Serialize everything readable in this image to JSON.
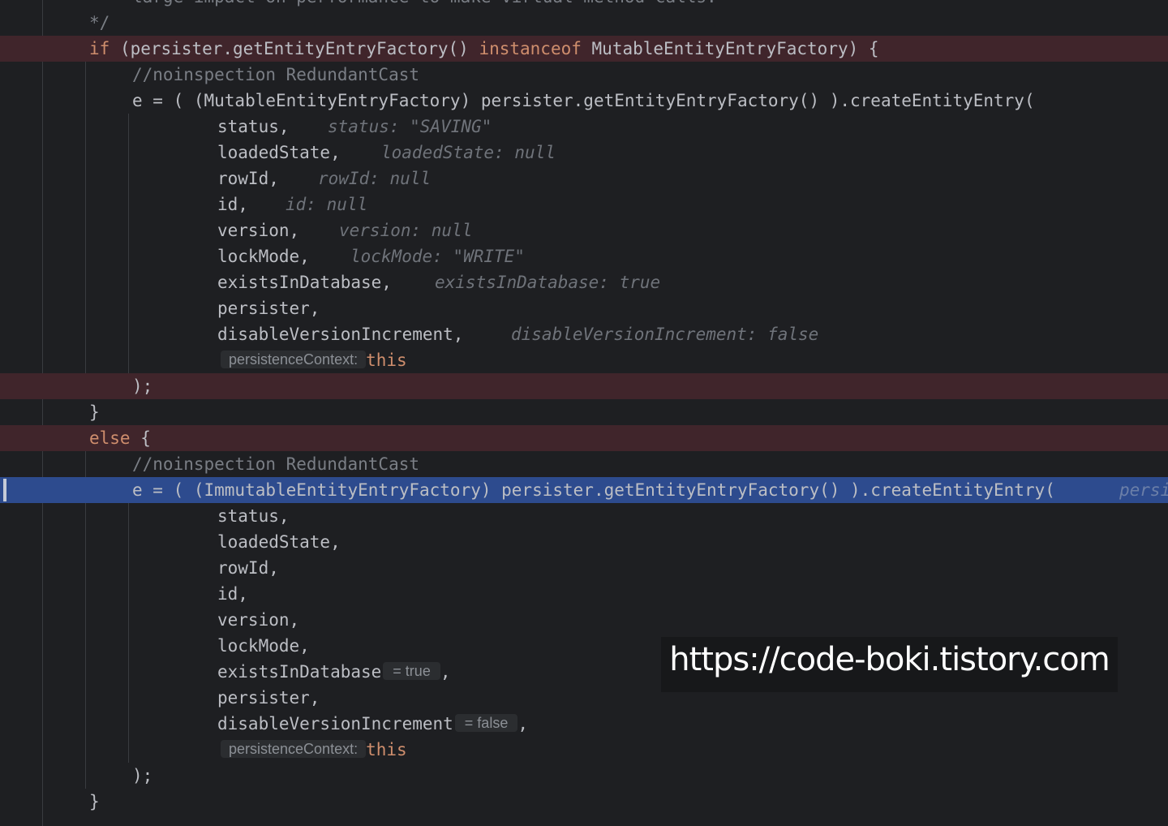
{
  "colors": {
    "background": "#1e1f22",
    "breakpoint_line": "#40252b",
    "execution_line": "#2d4b8e",
    "keyword": "#cf8e6d",
    "comment": "#7a7e85",
    "default_text": "#bcbec4"
  },
  "code": {
    "top_partial": "large impact on performance to make virtual method calls.",
    "comment_end": "*/",
    "if_kw": "if",
    "if_mid": " (persister.getEntityEntryFactory() ",
    "instanceof_kw": "instanceof",
    "if_tail": " MutableEntityEntryFactory) {",
    "noinspection_1": "//noinspection RedundantCast",
    "mutable_call": "e = ( (MutableEntityEntryFactory) persister.getEntityEntryFactory() ).createEntityEntry(",
    "arg_status": "status,",
    "hint_status": "status: \"SAVING\"",
    "arg_loadedState": "loadedState,",
    "hint_loadedState": "loadedState: null",
    "arg_rowId": "rowId,",
    "hint_rowId": "rowId: null",
    "arg_id": "id,",
    "hint_id": "id: null",
    "arg_version": "version,",
    "hint_version": "version: null",
    "arg_lockMode": "lockMode,",
    "hint_lockMode": "lockMode: \"WRITE\"",
    "arg_existsInDatabase": "existsInDatabase,",
    "hint_existsInDatabase": "existsInDatabase: true",
    "arg_persister": "persister,",
    "arg_disableVersionIncrement": "disableVersionIncrement,",
    "hint_disableVersionIncrement": "disableVersionIncrement: false",
    "param_persistenceContext": "persistenceContext:",
    "this_kw": "this",
    "close_call": ");",
    "close_brace": "}",
    "else_kw": "else",
    "else_brace": " {",
    "noinspection_2": "//noinspection RedundantCast",
    "immutable_call": "e = ( (ImmutableEntityEntryFactory) persister.getEntityEntryFactory() ).createEntityEntry(",
    "exec_hint": "persi",
    "arg2_status": "status,",
    "arg2_loadedState": "loadedState,",
    "arg2_rowId": "rowId,",
    "arg2_id": "id,",
    "arg2_version": "version,",
    "arg2_lockMode": "lockMode,",
    "arg2_existsInDatabase": "existsInDatabase",
    "inline_value_true": "= true",
    "comma": ",",
    "arg2_persister": "persister,",
    "arg2_disableVersionIncrement": "disableVersionIncrement",
    "inline_value_false": "= false",
    "param2_persistenceContext": "persistenceContext:",
    "this2_kw": "this",
    "close_call_2": ");",
    "close_brace_2": "}"
  },
  "watermark": {
    "text": "https://code-boki.tistory.com"
  }
}
